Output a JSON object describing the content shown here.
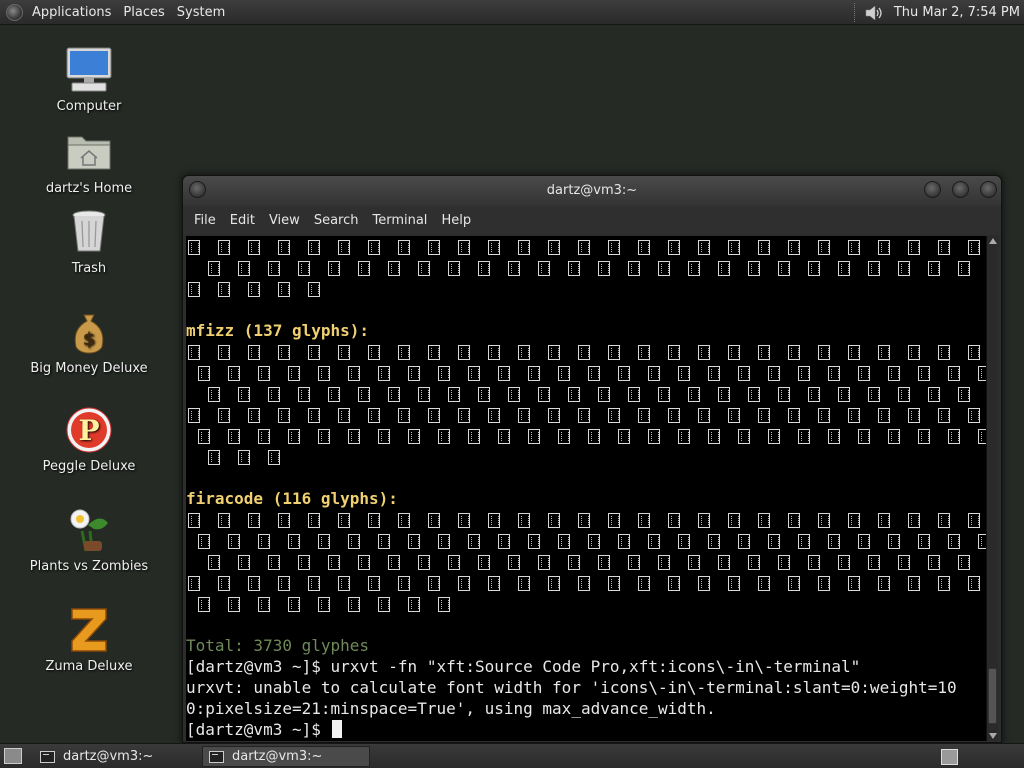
{
  "top_panel": {
    "menus": [
      "Applications",
      "Places",
      "System"
    ],
    "clock": "Thu Mar  2,  7:54 PM"
  },
  "desktop_icons": [
    {
      "label": "Computer",
      "icon": "computer-icon"
    },
    {
      "label": "dartz's Home",
      "icon": "home-folder-icon"
    },
    {
      "label": "Trash",
      "icon": "trash-icon"
    },
    {
      "label": "Big Money Deluxe",
      "icon": "money-bag-icon"
    },
    {
      "label": "Peggle Deluxe",
      "icon": "peggle-icon"
    },
    {
      "label": "Plants vs Zombies",
      "icon": "plants-icon"
    },
    {
      "label": "Zuma Deluxe",
      "icon": "zuma-icon"
    }
  ],
  "window": {
    "title": "dartz@vm3:~",
    "menu": [
      "File",
      "Edit",
      "View",
      "Search",
      "Terminal",
      "Help"
    ]
  },
  "terminal": {
    "header_mfizz": "mfizz (137 glyphs):",
    "header_firacode": "firacode (116 glyphs):",
    "total": "Total: 3730 glyphes",
    "cmd_line": "[dartz@vm3 ~]$ urxvt -fn \"xft:Source Code Pro,xft:icons\\-in\\-terminal\"",
    "error_line1": "urxvt: unable to calculate font width for 'icons\\-in\\-terminal:slant=0:weight=10",
    "error_line2": "0:pixelsize=21:minspace=True', using max_advance_width.",
    "prompt": "[dartz@vm3 ~]$ "
  },
  "taskbar": {
    "tasks": [
      "dartz@vm3:~",
      "dartz@vm3:~"
    ]
  },
  "colors": {
    "header": "#f0d070",
    "total": "#6f8a5a",
    "terminal_bg": "#000000",
    "desktop_bg": "#252a25"
  }
}
